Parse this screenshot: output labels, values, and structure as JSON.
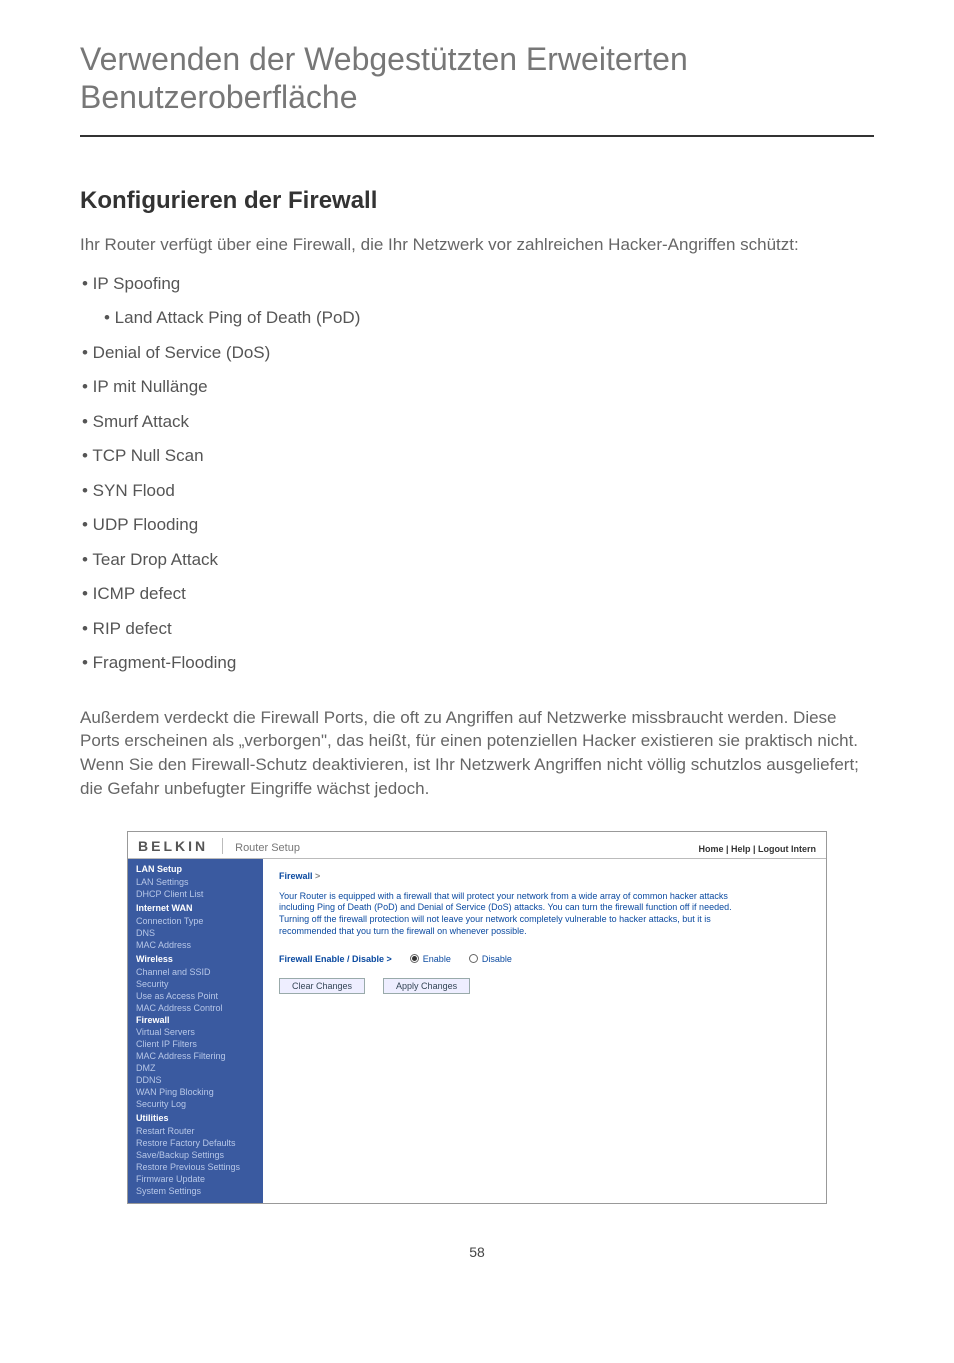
{
  "page": {
    "title": "Verwenden der Webgestützten Erweiterten Benutzeroberfläche",
    "section_heading": "Konfigurieren der Firewall",
    "intro": "Ihr Router verfügt über eine Firewall, die Ihr Netzwerk vor zahlreichen Hacker-Angriffen schützt:",
    "bullets": [
      {
        "text": "• IP Spoofing",
        "indented": false
      },
      {
        "text": "•    Land Attack Ping of Death (PoD)",
        "indented": true
      },
      {
        "text": "• Denial of Service (DoS)",
        "indented": false
      },
      {
        "text": "• IP mit Nullänge",
        "indented": false
      },
      {
        "text": "• Smurf Attack",
        "indented": false
      },
      {
        "text": "• TCP Null Scan",
        "indented": false
      },
      {
        "text": "• SYN Flood",
        "indented": false
      },
      {
        "text": "• UDP Flooding",
        "indented": false
      },
      {
        "text": "• Tear Drop Attack",
        "indented": false
      },
      {
        "text": "• ICMP defect",
        "indented": false
      },
      {
        "text": "• RIP defect",
        "indented": false
      },
      {
        "text": "• Fragment-Flooding",
        "indented": false
      }
    ],
    "body_para": "Außerdem verdeckt die Firewall Ports, die oft zu Angriffen auf Netzwerke missbraucht werden. Diese Ports erscheinen als „verborgen\", das heißt, für einen potenziellen Hacker existieren sie praktisch nicht. Wenn Sie den Firewall-Schutz deaktivieren, ist Ihr Netzwerk Angriffen nicht völlig schutzlos ausgeliefert; die Gefahr unbefugter Eingriffe wächst jedoch.",
    "page_number": "58"
  },
  "router": {
    "logo": "BELKIN",
    "title": "Router Setup",
    "header_links": "Home | Help | Logout   Intern",
    "sidebar": [
      {
        "type": "cat",
        "label": "LAN Setup"
      },
      {
        "type": "item",
        "label": "LAN Settings"
      },
      {
        "type": "item",
        "label": "DHCP Client List"
      },
      {
        "type": "cat",
        "label": "Internet WAN"
      },
      {
        "type": "item",
        "label": "Connection Type"
      },
      {
        "type": "item",
        "label": "DNS"
      },
      {
        "type": "item",
        "label": "MAC Address"
      },
      {
        "type": "cat",
        "label": "Wireless"
      },
      {
        "type": "item",
        "label": "Channel and SSID"
      },
      {
        "type": "item",
        "label": "Security"
      },
      {
        "type": "item",
        "label": "Use as Access Point"
      },
      {
        "type": "item",
        "label": "MAC Address Control"
      },
      {
        "type": "item",
        "label": "Firewall",
        "active": true
      },
      {
        "type": "item",
        "label": "Virtual Servers"
      },
      {
        "type": "item",
        "label": "Client IP Filters"
      },
      {
        "type": "item",
        "label": "MAC Address Filtering"
      },
      {
        "type": "item",
        "label": "DMZ"
      },
      {
        "type": "item",
        "label": "DDNS"
      },
      {
        "type": "item",
        "label": "WAN Ping Blocking"
      },
      {
        "type": "item",
        "label": "Security Log"
      },
      {
        "type": "cat",
        "label": "Utilities"
      },
      {
        "type": "item",
        "label": "Restart Router"
      },
      {
        "type": "item",
        "label": "Restore Factory Defaults"
      },
      {
        "type": "item",
        "label": "Save/Backup Settings"
      },
      {
        "type": "item",
        "label": "Restore Previous Settings"
      },
      {
        "type": "item",
        "label": "Firmware Update"
      },
      {
        "type": "item",
        "label": "System Settings"
      }
    ],
    "main": {
      "breadcrumb": "Firewall",
      "breadcrumb_sep": " >",
      "description": "Your Router is equipped with a firewall that will protect your network from a wide array of common hacker attacks including Ping of Death (PoD) and Denial of Service (DoS) attacks. You can turn the firewall function off if needed. Turning off the firewall protection will not leave your network completely vulnerable to hacker attacks, but it is recommended that you turn the firewall on whenever possible.",
      "toggle_label": "Firewall Enable / Disable >",
      "enable_label": "Enable",
      "disable_label": "Disable",
      "clear_btn": "Clear Changes",
      "apply_btn": "Apply Changes"
    }
  }
}
